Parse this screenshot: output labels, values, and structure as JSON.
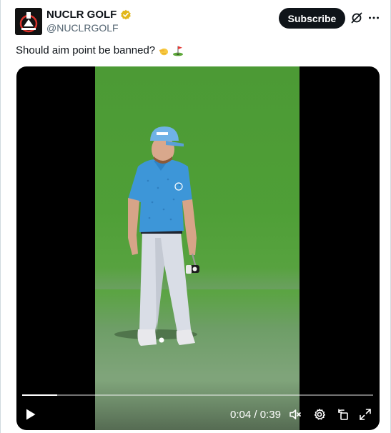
{
  "post": {
    "author_name": "NUCLR GOLF",
    "author_handle": "@NUCLRGOLF",
    "verified": true,
    "subscribe_label": "Subscribe",
    "text": "Should aim point be banned?",
    "emojis": [
      "pointing-hand-emoji",
      "golf-flag-emoji"
    ]
  },
  "video": {
    "current_time": "0:04",
    "duration": "0:39",
    "time_separator": " / ",
    "progress": 0.1,
    "controls": [
      "play-icon",
      "mute-icon",
      "settings-icon",
      "rotate-icon",
      "fullscreen-icon"
    ]
  },
  "colors": {
    "text_primary": "#0f1419",
    "text_secondary": "#536471",
    "verified_gold": "#e2b719",
    "grass": "#4f9f37",
    "green_surface": "#7fa47a",
    "shirt_blue": "#3d96d8"
  }
}
